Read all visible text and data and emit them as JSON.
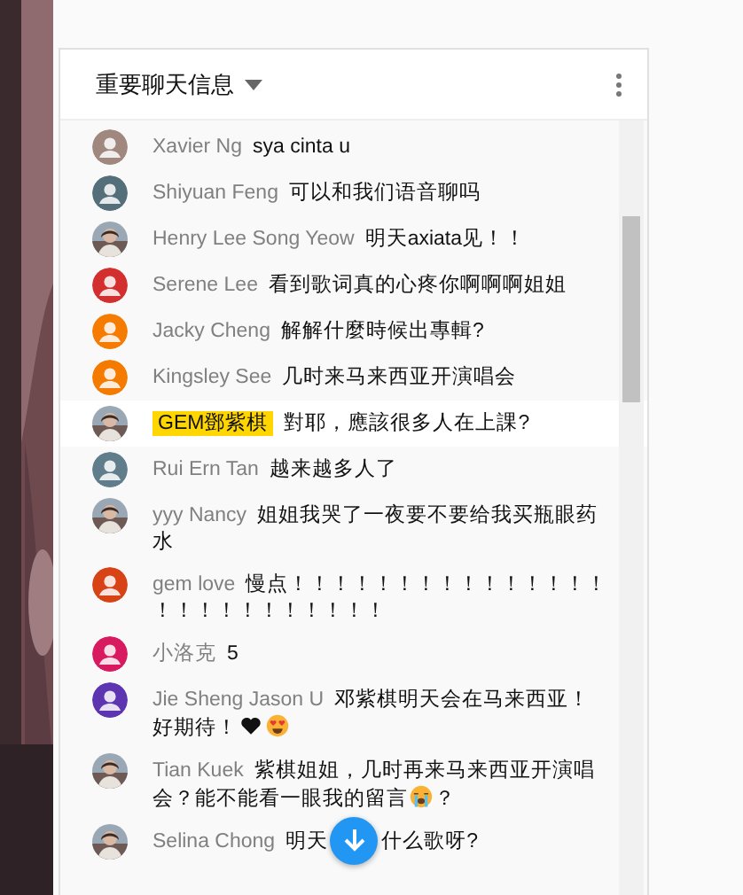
{
  "header": {
    "title": "重要聊天信息"
  },
  "messages": [
    {
      "author": "Xavier Ng",
      "highlighted": false,
      "avatar": {
        "kind": "silhouette",
        "color": "#a1887f"
      },
      "parts": [
        {
          "kind": "text",
          "text": "sya cinta u"
        }
      ]
    },
    {
      "author": "Shiyuan Feng",
      "highlighted": false,
      "avatar": {
        "kind": "silhouette",
        "color": "#546e7a"
      },
      "parts": [
        {
          "kind": "text",
          "text": "可以和我们语音聊吗"
        }
      ]
    },
    {
      "author": "Henry Lee Song Yeow",
      "highlighted": false,
      "parts": [
        {
          "kind": "text",
          "text": "明天axiata见！！"
        }
      ]
    },
    {
      "author": "Serene Lee",
      "highlighted": false,
      "avatar": {
        "kind": "silhouette",
        "color": "#d32f2f"
      },
      "parts": [
        {
          "kind": "text",
          "text": "看到歌词真的心疼你啊啊啊姐姐"
        }
      ]
    },
    {
      "author": "Jacky Cheng",
      "highlighted": false,
      "avatar": {
        "kind": "silhouette",
        "color": "#f57c00"
      },
      "parts": [
        {
          "kind": "text",
          "text": "解解什麼時候出專輯?"
        }
      ]
    },
    {
      "author": "Kingsley See",
      "highlighted": false,
      "avatar": {
        "kind": "silhouette",
        "color": "#f57b00"
      },
      "parts": [
        {
          "kind": "text",
          "text": "几时来马来西亚开演唱会"
        }
      ]
    },
    {
      "author": "GEM鄧紫棋",
      "highlighted": true,
      "parts": [
        {
          "kind": "text",
          "text": "對耶，應該很多人在上課?"
        }
      ]
    },
    {
      "author": "Rui Ern Tan",
      "highlighted": false,
      "avatar": {
        "kind": "silhouette",
        "color": "#607d8b"
      },
      "parts": [
        {
          "kind": "text",
          "text": "越来越多人了"
        }
      ]
    },
    {
      "author": "yyy Nancy",
      "highlighted": false,
      "parts": [
        {
          "kind": "text",
          "text": "姐姐我哭了一夜要不要给我买瓶眼药水"
        }
      ]
    },
    {
      "author": "gem love",
      "highlighted": false,
      "avatar": {
        "kind": "silhouette",
        "color": "#d84315"
      },
      "parts": [
        {
          "kind": "text",
          "text": "慢点！！！！！！！！！！！！！！！！！！！！！！！！！！"
        }
      ]
    },
    {
      "author": "小洛克",
      "highlighted": false,
      "avatar": {
        "kind": "silhouette",
        "color": "#d81b60"
      },
      "parts": [
        {
          "kind": "text",
          "text": "5"
        }
      ]
    },
    {
      "author": "Jie Sheng Jason U",
      "highlighted": false,
      "avatar": {
        "kind": "silhouette",
        "color": "#5e35b1"
      },
      "parts": [
        {
          "kind": "text",
          "text": "邓紫棋明天会在马来西亚！好期待！"
        },
        {
          "kind": "heart"
        },
        {
          "kind": "heart-eyes"
        }
      ]
    },
    {
      "author": "Tian Kuek",
      "highlighted": false,
      "parts": [
        {
          "kind": "text",
          "text": "紫棋姐姐，几时再来马来西亚开演唱会？能不能看一眼我的留言"
        },
        {
          "kind": "crying"
        },
        {
          "kind": "text",
          "text": "？"
        }
      ]
    },
    {
      "author": "Selina Chong",
      "highlighted": false,
      "parts": [
        {
          "kind": "text",
          "text": "明天"
        },
        {
          "kind": "hidden"
        },
        {
          "kind": "text",
          "text": "什么歌呀?"
        }
      ]
    }
  ]
}
